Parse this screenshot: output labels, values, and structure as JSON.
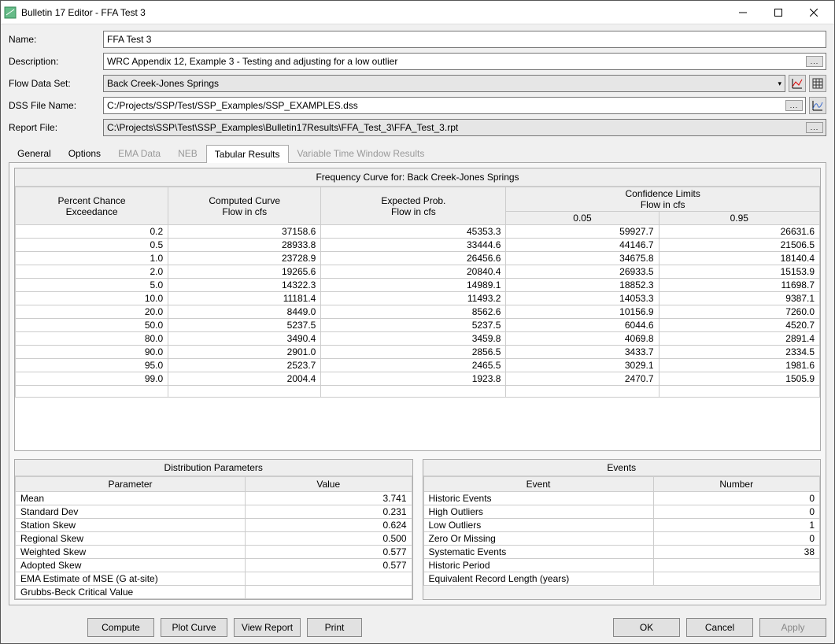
{
  "window": {
    "title": "Bulletin 17 Editor - FFA Test 3"
  },
  "form": {
    "name_label": "Name:",
    "name_value": "FFA Test 3",
    "desc_label": "Description:",
    "desc_value": "WRC Appendix 12, Example 3 - Testing and adjusting for a low outlier",
    "flow_label": "Flow Data Set:",
    "flow_value": "Back Creek-Jones Springs",
    "dss_label": "DSS File Name:",
    "dss_value": "C:/Projects/SSP/Test/SSP_Examples/SSP_EXAMPLES.dss",
    "report_label": "Report File:",
    "report_value": "C:\\Projects\\SSP\\Test\\SSP_Examples\\Bulletin17Results\\FFA_Test_3\\FFA_Test_3.rpt",
    "dots": "..."
  },
  "tabs": {
    "general": "General",
    "options": "Options",
    "ema": "EMA Data",
    "neb": "NEB",
    "tabular": "Tabular Results",
    "vtw": "Variable Time Window Results"
  },
  "freq": {
    "title": "Frequency Curve for: Back Creek-Jones Springs",
    "hdr_pct1": "Percent Chance",
    "hdr_pct2": "Exceedance",
    "hdr_comp1": "Computed Curve",
    "hdr_comp2": "Flow in cfs",
    "hdr_exp1": "Expected Prob.",
    "hdr_exp2": "Flow in cfs",
    "hdr_conf1": "Confidence Limits",
    "hdr_conf2": "Flow in cfs",
    "hdr_005": "0.05",
    "hdr_095": "0.95",
    "rows": [
      {
        "p": "0.2",
        "c": "37158.6",
        "e": "45353.3",
        "l": "59927.7",
        "u": "26631.6"
      },
      {
        "p": "0.5",
        "c": "28933.8",
        "e": "33444.6",
        "l": "44146.7",
        "u": "21506.5"
      },
      {
        "p": "1.0",
        "c": "23728.9",
        "e": "26456.6",
        "l": "34675.8",
        "u": "18140.4"
      },
      {
        "p": "2.0",
        "c": "19265.6",
        "e": "20840.4",
        "l": "26933.5",
        "u": "15153.9"
      },
      {
        "p": "5.0",
        "c": "14322.3",
        "e": "14989.1",
        "l": "18852.3",
        "u": "11698.7"
      },
      {
        "p": "10.0",
        "c": "11181.4",
        "e": "11493.2",
        "l": "14053.3",
        "u": "9387.1"
      },
      {
        "p": "20.0",
        "c": "8449.0",
        "e": "8562.6",
        "l": "10156.9",
        "u": "7260.0"
      },
      {
        "p": "50.0",
        "c": "5237.5",
        "e": "5237.5",
        "l": "6044.6",
        "u": "4520.7"
      },
      {
        "p": "80.0",
        "c": "3490.4",
        "e": "3459.8",
        "l": "4069.8",
        "u": "2891.4"
      },
      {
        "p": "90.0",
        "c": "2901.0",
        "e": "2856.5",
        "l": "3433.7",
        "u": "2334.5"
      },
      {
        "p": "95.0",
        "c": "2523.7",
        "e": "2465.5",
        "l": "3029.1",
        "u": "1981.6"
      },
      {
        "p": "99.0",
        "c": "2004.4",
        "e": "1923.8",
        "l": "2470.7",
        "u": "1505.9"
      }
    ]
  },
  "dist": {
    "title": "Distribution Parameters",
    "hdr_param": "Parameter",
    "hdr_value": "Value",
    "rows": [
      {
        "k": "Mean",
        "v": "3.741"
      },
      {
        "k": "Standard Dev",
        "v": "0.231"
      },
      {
        "k": "Station Skew",
        "v": "0.624"
      },
      {
        "k": "Regional Skew",
        "v": "0.500"
      },
      {
        "k": "Weighted Skew",
        "v": "0.577"
      },
      {
        "k": "Adopted Skew",
        "v": "0.577"
      },
      {
        "k": "EMA Estimate of MSE (G at-site)",
        "v": ""
      },
      {
        "k": "Grubbs-Beck Critical Value",
        "v": ""
      }
    ]
  },
  "events": {
    "title": "Events",
    "hdr_event": "Event",
    "hdr_num": "Number",
    "rows": [
      {
        "k": "Historic Events",
        "v": "0"
      },
      {
        "k": "High Outliers",
        "v": "0"
      },
      {
        "k": "Low Outliers",
        "v": "1"
      },
      {
        "k": "Zero Or Missing",
        "v": "0"
      },
      {
        "k": "Systematic Events",
        "v": "38"
      },
      {
        "k": "Historic Period",
        "v": ""
      },
      {
        "k": "Equivalent Record Length (years)",
        "v": ""
      }
    ]
  },
  "buttons": {
    "compute": "Compute",
    "plot": "Plot Curve",
    "view": "View Report",
    "print": "Print",
    "ok": "OK",
    "cancel": "Cancel",
    "apply": "Apply"
  }
}
